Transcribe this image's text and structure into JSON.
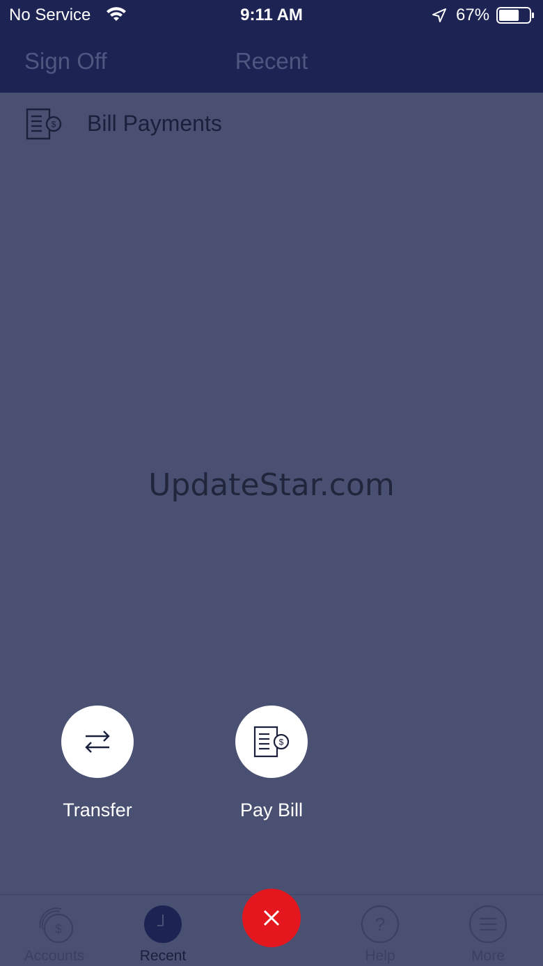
{
  "status_bar": {
    "carrier": "No Service",
    "time": "9:11 AM",
    "battery_percent": "67%",
    "battery_level": 0.67
  },
  "nav": {
    "left_label": "Sign Off",
    "title": "Recent"
  },
  "recent_items": [
    {
      "label": "Bill Payments",
      "icon": "bill-document-icon"
    }
  ],
  "watermark": "UpdateStar.com",
  "actions": [
    {
      "label": "Transfer",
      "icon": "transfer-arrows-icon"
    },
    {
      "label": "Pay Bill",
      "icon": "bill-document-icon"
    }
  ],
  "tabs": [
    {
      "label": "Accounts",
      "icon": "accounts-dollar-icon",
      "active": false
    },
    {
      "label": "Recent",
      "icon": "clock-icon",
      "active": true
    },
    {
      "label": "",
      "icon": "close-icon",
      "active": false
    },
    {
      "label": "Help",
      "icon": "question-icon",
      "active": false
    },
    {
      "label": "More",
      "icon": "menu-icon",
      "active": false
    }
  ],
  "colors": {
    "nav_background": "#1d2454",
    "overlay": "#4a5071",
    "close_button": "#e3171d",
    "action_circle": "#ffffff"
  }
}
